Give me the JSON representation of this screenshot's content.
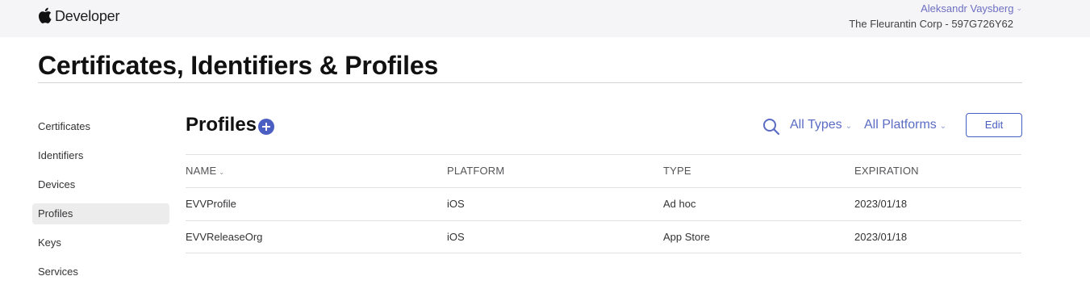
{
  "header": {
    "brand_label": "Developer",
    "user_name": "Aleksandr Vaysberg",
    "team": "The Fleurantin Corp - 597G726Y62"
  },
  "page_title": "Certificates, Identifiers & Profiles",
  "sidebar": {
    "items": [
      {
        "label": "Certificates",
        "active": false
      },
      {
        "label": "Identifiers",
        "active": false
      },
      {
        "label": "Devices",
        "active": false
      },
      {
        "label": "Profiles",
        "active": true
      },
      {
        "label": "Keys",
        "active": false
      },
      {
        "label": "Services",
        "active": false
      }
    ]
  },
  "main": {
    "section_title": "Profiles",
    "filters": {
      "types": "All Types",
      "platforms": "All Platforms"
    },
    "edit_label": "Edit",
    "table": {
      "columns": [
        "NAME",
        "PLATFORM",
        "TYPE",
        "EXPIRATION"
      ],
      "rows": [
        {
          "name": "EVVProfile",
          "platform": "iOS",
          "type": "Ad hoc",
          "expiration": "2023/01/18"
        },
        {
          "name": "EVVReleaseOrg",
          "platform": "iOS",
          "type": "App Store",
          "expiration": "2023/01/18"
        }
      ]
    }
  },
  "colors": {
    "accent": "#4a5fc1",
    "link": "#5a6cc4",
    "topbar_bg": "#f5f5f7",
    "active_bg": "#ececec"
  },
  "icons": {
    "brand": "apple-logo-icon",
    "add": "plus-circle-icon",
    "search": "search-icon",
    "dropdown": "chevron-down-icon"
  }
}
